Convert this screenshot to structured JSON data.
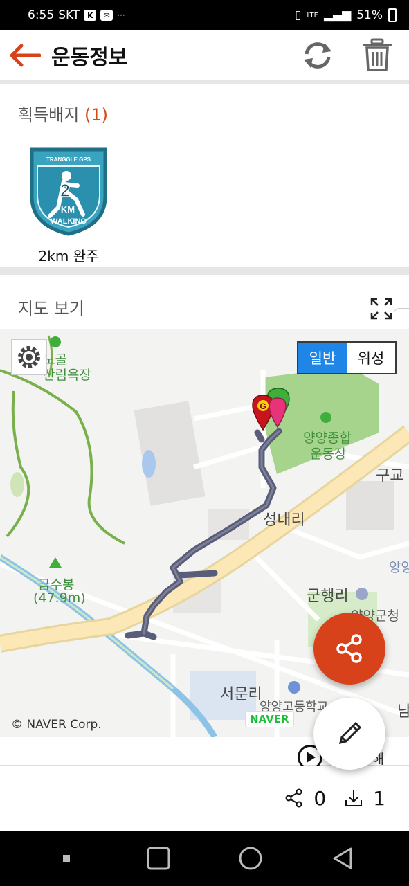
{
  "status_bar": {
    "time": "6:55",
    "carrier": "SKT",
    "battery": "51%",
    "dots": "···"
  },
  "app_bar": {
    "title": "운동정보",
    "back_icon": "arrow-left-icon",
    "refresh_icon": "refresh-icon",
    "delete_icon": "trash-icon"
  },
  "badges": {
    "title": "획득배지",
    "count": "(1)",
    "items": [
      {
        "label": "2km 완주",
        "top_text": "TRANGGLE GPS",
        "number": "2",
        "unit": "KM",
        "ribbon": "WALKING"
      }
    ]
  },
  "map": {
    "title": "지도 보기",
    "toggle_normal": "일반",
    "toggle_satellite": "위성",
    "copyright": "© NAVER Corp.",
    "naver": "NAVER",
    "labels": {
      "l1": "노골",
      "l2": "산림욕장",
      "l3": "양양종합",
      "l4": "운동장",
      "l5": "구교",
      "l6": "성내리",
      "l7": "금수봉",
      "l8": "(47.9m)",
      "l9": "군행리",
      "l10": "양양군청",
      "l11": "양양",
      "l12": "서문리",
      "l13": "양양고등학교",
      "l14": "남"
    },
    "start_marker": "G",
    "colors": {
      "route": "#5a5d7a",
      "park": "#a6d48c",
      "road": "#fbe8b6"
    }
  },
  "strip": {
    "text": "수해"
  },
  "stats": {
    "shares": "0",
    "downloads": "1"
  },
  "colors": {
    "accent": "#d8421a",
    "toggle": "#1f86e8"
  }
}
